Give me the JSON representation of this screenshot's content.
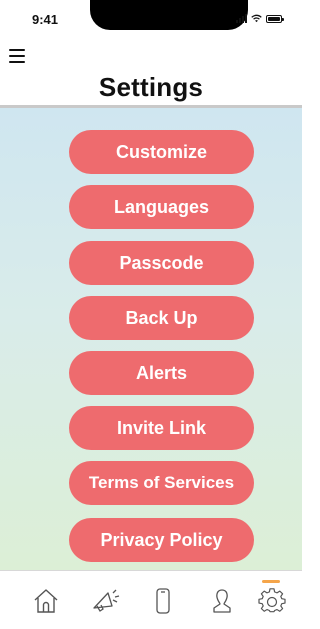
{
  "status_bar": {
    "time": "9:41"
  },
  "header": {
    "title": "Settings"
  },
  "menu": [
    {
      "id": "customize",
      "label": "Customize"
    },
    {
      "id": "languages",
      "label": "Languages"
    },
    {
      "id": "passcode",
      "label": "Passcode"
    },
    {
      "id": "back-up",
      "label": "Back Up"
    },
    {
      "id": "alerts",
      "label": "Alerts"
    },
    {
      "id": "invite-link",
      "label": "Invite Link"
    },
    {
      "id": "terms",
      "label": "Terms of Services"
    },
    {
      "id": "privacy",
      "label": "Privacy Policy"
    }
  ],
  "tab_bar": {
    "tabs": [
      {
        "icon": "home-icon"
      },
      {
        "icon": "megaphone-icon"
      },
      {
        "icon": "phone-icon"
      },
      {
        "icon": "user-icon"
      },
      {
        "icon": "gear-icon",
        "active": true
      }
    ],
    "active_color": "#f5a54a"
  },
  "colors": {
    "button": "#ee6b6e",
    "button_text": "#ffffff",
    "background_top": "#cfe6f0",
    "background_bottom": "#dcefd6"
  }
}
